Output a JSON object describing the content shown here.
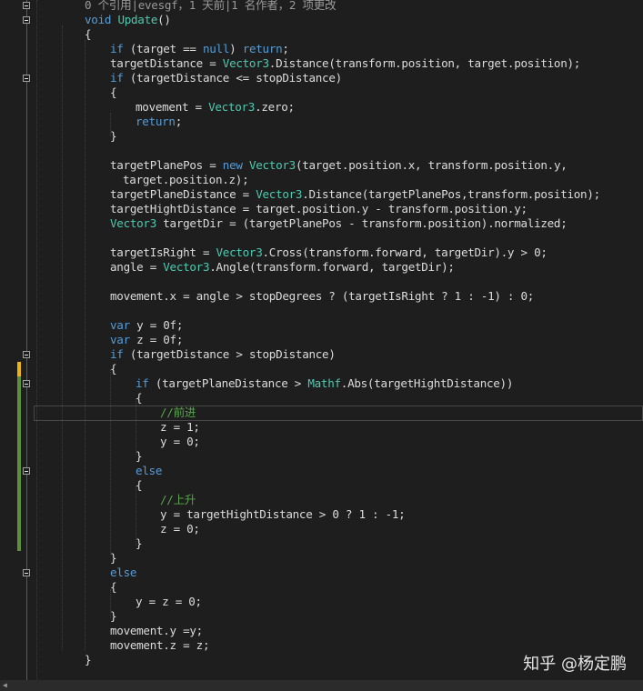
{
  "codelens": "0 个引用|evesgf，1 天前|1 名作者，2 项更改",
  "lines": [
    [
      [
        "kw",
        "void"
      ],
      [
        "tx",
        " "
      ],
      [
        "ty",
        "Update"
      ],
      [
        "tx",
        "()"
      ]
    ],
    [
      [
        "tx",
        "{"
      ]
    ],
    [
      [
        "kw",
        "if"
      ],
      [
        "tx",
        " (target == "
      ],
      [
        "kw",
        "null"
      ],
      [
        "tx",
        ") "
      ],
      [
        "kw",
        "return"
      ],
      [
        "tx",
        ";"
      ]
    ],
    [
      [
        "tx",
        "targetDistance = "
      ],
      [
        "ty",
        "Vector3"
      ],
      [
        "tx",
        ".Distance(transform.position, target.position);"
      ]
    ],
    [
      [
        "kw",
        "if"
      ],
      [
        "tx",
        " (targetDistance <= stopDistance)"
      ]
    ],
    [
      [
        "tx",
        "{"
      ]
    ],
    [
      [
        "tx",
        "movement = "
      ],
      [
        "ty",
        "Vector3"
      ],
      [
        "tx",
        ".zero;"
      ]
    ],
    [
      [
        "kw",
        "return"
      ],
      [
        "tx",
        ";"
      ]
    ],
    [
      [
        "tx",
        "}"
      ]
    ],
    [],
    [
      [
        "tx",
        "targetPlanePos = "
      ],
      [
        "kw",
        "new"
      ],
      [
        "tx",
        " "
      ],
      [
        "ty",
        "Vector3"
      ],
      [
        "tx",
        "(target.position.x, transform.position.y,"
      ]
    ],
    [
      [
        "tx",
        "target.position.z);"
      ]
    ],
    [
      [
        "tx",
        "targetPlaneDistance = "
      ],
      [
        "ty",
        "Vector3"
      ],
      [
        "tx",
        ".Distance(targetPlanePos,transform.position);"
      ]
    ],
    [
      [
        "tx",
        "targetHightDistance = target.position.y - transform.position.y;"
      ]
    ],
    [
      [
        "ty",
        "Vector3"
      ],
      [
        "tx",
        " targetDir = (targetPlanePos - transform.position).normalized;"
      ]
    ],
    [],
    [
      [
        "tx",
        "targetIsRight = "
      ],
      [
        "ty",
        "Vector3"
      ],
      [
        "tx",
        ".Cross(transform.forward, targetDir).y > 0;"
      ]
    ],
    [
      [
        "tx",
        "angle = "
      ],
      [
        "ty",
        "Vector3"
      ],
      [
        "tx",
        ".Angle(transform.forward, targetDir);"
      ]
    ],
    [],
    [
      [
        "tx",
        "movement.x = angle > stopDegrees ? (targetIsRight ? 1 : -1) : 0;"
      ]
    ],
    [],
    [
      [
        "kw",
        "var"
      ],
      [
        "tx",
        " y = 0f;"
      ]
    ],
    [
      [
        "kw",
        "var"
      ],
      [
        "tx",
        " z = 0f;"
      ]
    ],
    [
      [
        "kw",
        "if"
      ],
      [
        "tx",
        " (targetDistance > stopDistance)"
      ]
    ],
    [
      [
        "tx",
        "{"
      ]
    ],
    [
      [
        "kw",
        "if"
      ],
      [
        "tx",
        " (targetPlaneDistance > "
      ],
      [
        "ty",
        "Mathf"
      ],
      [
        "tx",
        ".Abs(targetHightDistance))"
      ]
    ],
    [
      [
        "tx",
        "{"
      ]
    ],
    [
      [
        "cm",
        "//前进"
      ]
    ],
    [
      [
        "tx",
        "z = 1;"
      ]
    ],
    [
      [
        "tx",
        "y = 0;"
      ]
    ],
    [
      [
        "tx",
        "}"
      ]
    ],
    [
      [
        "kw",
        "else"
      ]
    ],
    [
      [
        "tx",
        "{"
      ]
    ],
    [
      [
        "cm",
        "//上升"
      ]
    ],
    [
      [
        "tx",
        "y = targetHightDistance > 0 ? 1 : -1;"
      ]
    ],
    [
      [
        "tx",
        "z = 0;"
      ]
    ],
    [
      [
        "tx",
        "}"
      ]
    ],
    [
      [
        "tx",
        "}"
      ]
    ],
    [
      [
        "kw",
        "else"
      ]
    ],
    [
      [
        "tx",
        "{"
      ]
    ],
    [
      [
        "tx",
        "y = z = 0;"
      ]
    ],
    [
      [
        "tx",
        "}"
      ]
    ],
    [
      [
        "tx",
        "movement.y =y;"
      ]
    ],
    [
      [
        "tx",
        "movement.z = z;"
      ]
    ],
    [
      [
        "tx",
        "}"
      ]
    ]
  ],
  "watermark": "知乎 @杨定鹏",
  "colors": {
    "background": "#1e1e1e",
    "text": "#dcdcdc",
    "keyword": "#569cd6",
    "type": "#4ec9b0",
    "comment": "#57a64a",
    "codelens": "#999999",
    "changed_saved": "#5f8f3d",
    "changed_unsaved": "#efb50f"
  }
}
